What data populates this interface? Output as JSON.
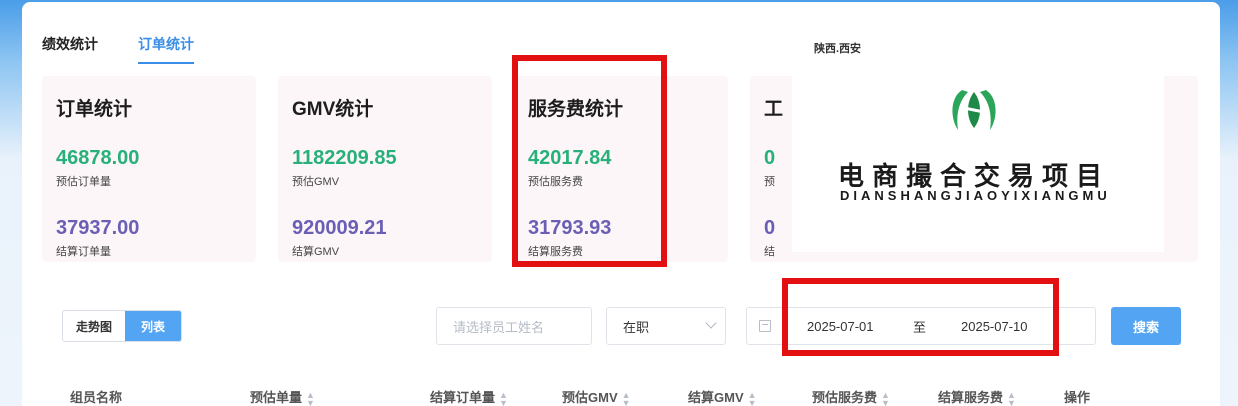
{
  "tabs": [
    {
      "label": "绩效统计"
    },
    {
      "label": "订单统计"
    }
  ],
  "cards": [
    {
      "title": "订单统计",
      "value1": "46878.00",
      "label1": "预估订单量",
      "value2": "37937.00",
      "label2": "结算订单量"
    },
    {
      "title": "GMV统计",
      "value1": "1182209.85",
      "label1": "预估GMV",
      "value2": "920009.21",
      "label2": "结算GMV"
    },
    {
      "title": "服务费统计",
      "value1": "42017.84",
      "label1": "预估服务费",
      "value2": "31793.93",
      "label2": "结算服务费"
    },
    {
      "title": "工",
      "value1": "0",
      "label1": "预",
      "value2": "0",
      "label2": "结"
    }
  ],
  "logo": {
    "location": "陕西.西安",
    "cn": "电商撮合交易项目",
    "en": "DIANSHANGJIAOYIXIANGMU"
  },
  "view_toggle": {
    "trend": "走势图",
    "list": "列表"
  },
  "filters": {
    "employee_placeholder": "请选择员工姓名",
    "status": "在职",
    "date_start": "2025-07-01",
    "date_sep": "至",
    "date_end": "2025-07-10",
    "search": "搜索"
  },
  "table": {
    "headers": [
      "组员名称",
      "预估单量",
      "结算订单量",
      "预估GMV",
      "结算GMV",
      "预估服务费",
      "结算服务费",
      "操作"
    ]
  },
  "colors": {
    "accent": "#53a4f2",
    "green": "#27b07a",
    "purple": "#6a5fb5",
    "highlight": "#e21010"
  }
}
